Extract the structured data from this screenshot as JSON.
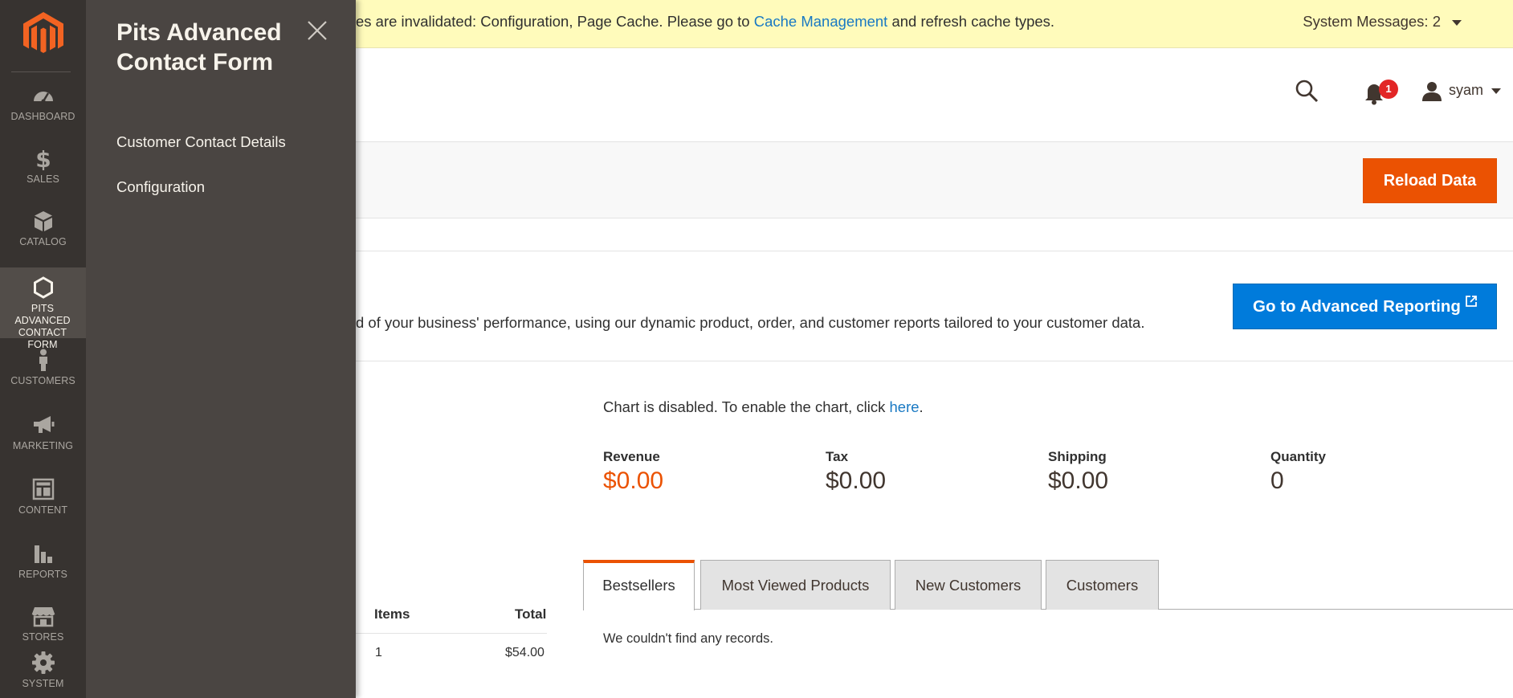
{
  "nav": {
    "items": [
      {
        "label": "DASHBOARD",
        "icon": "dashboard-icon"
      },
      {
        "label": "SALES",
        "icon": "dollar-icon"
      },
      {
        "label": "CATALOG",
        "icon": "box-icon"
      },
      {
        "label": "PITS ADVANCED CONTACT FORM",
        "icon": "hexagon-icon"
      },
      {
        "label": "CUSTOMERS",
        "icon": "person-icon"
      },
      {
        "label": "MARKETING",
        "icon": "megaphone-icon"
      },
      {
        "label": "CONTENT",
        "icon": "layout-icon"
      },
      {
        "label": "REPORTS",
        "icon": "bar-chart-icon"
      },
      {
        "label": "STORES",
        "icon": "storefront-icon"
      },
      {
        "label": "SYSTEM",
        "icon": "gear-icon"
      }
    ]
  },
  "flyout": {
    "title": "Pits Advanced Contact Form",
    "links": [
      "Customer Contact Details",
      "Configuration"
    ]
  },
  "system_message": {
    "text_before": "es are invalidated: Configuration, Page Cache. Please go to ",
    "link": "Cache Management",
    "text_after": " and refresh cache types.",
    "counter": "System Messages: 2"
  },
  "header": {
    "notification_count": "1",
    "username": "syam"
  },
  "actions": {
    "reload_label": "Reload Data"
  },
  "advanced_reporting": {
    "text": "d of your business' performance, using our dynamic product, order, and customer reports tailored to your customer data.",
    "button_label": "Go to Advanced Reporting"
  },
  "chart_note": {
    "text": "Chart is disabled. To enable the chart, click ",
    "link": "here",
    "suffix": "."
  },
  "totals": [
    {
      "label": "Revenue",
      "value": "$0.00"
    },
    {
      "label": "Tax",
      "value": "$0.00"
    },
    {
      "label": "Shipping",
      "value": "$0.00"
    },
    {
      "label": "Quantity",
      "value": "0"
    }
  ],
  "orders": {
    "headers": [
      "Items",
      "Total"
    ],
    "rows": [
      [
        "1",
        "$54.00"
      ]
    ]
  },
  "tabs": {
    "items": [
      "Bestsellers",
      "Most Viewed Products",
      "New Customers",
      "Customers"
    ],
    "active": "Bestsellers",
    "empty_message": "We couldn't find any records."
  },
  "colors": {
    "nav_bg": "#373330",
    "flyout_bg": "#4a4542",
    "sysbar_bg": "#fffbbb",
    "accent_orange": "#eb5202",
    "link_blue": "#1979c3",
    "button_blue": "#007bdb"
  }
}
